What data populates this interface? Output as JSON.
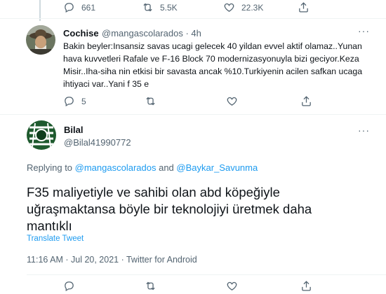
{
  "top_actions": {
    "replies": "661",
    "retweets": "5.5K",
    "likes": "22.3K"
  },
  "reply_tweet": {
    "author_name": "Cochise",
    "author_handle": "@mangascolarados",
    "separator": " · ",
    "time_ago": "4h",
    "text": "Bakin beyler:Insansiz savas ucagi gelecek 40 yildan evvel aktif olamaz..Yunan hava kuvvetleri Rafale ve F-16 Block 70 modernizasyonuyla bizi geciyor.Keza Misir..Iha-siha nin etkisi bir savasta ancak %10.Turkiyenin acilen safkan ucaga ihtiyaci var..Yani f 35 e",
    "replies": "5"
  },
  "main_tweet": {
    "author_name": "Bilal",
    "author_handle": "@Bilal41990772",
    "replying_prefix": "Replying to ",
    "reply_to_1": "@mangascolarados",
    "reply_and": " and ",
    "reply_to_2": "@Baykar_Savunma",
    "text": "F35 maliyetiyle ve sahibi olan abd köpeğiyle uğraşmaktansa böyle bir teknolojiyi üretmek daha mantıklı",
    "translate": "Translate Tweet",
    "timestamp": "11:16 AM · Jul 20, 2021 · Twitter for Android"
  },
  "colors": {
    "link": "#1d9bf0",
    "secondary": "#536471",
    "divider": "#eff3f4"
  }
}
